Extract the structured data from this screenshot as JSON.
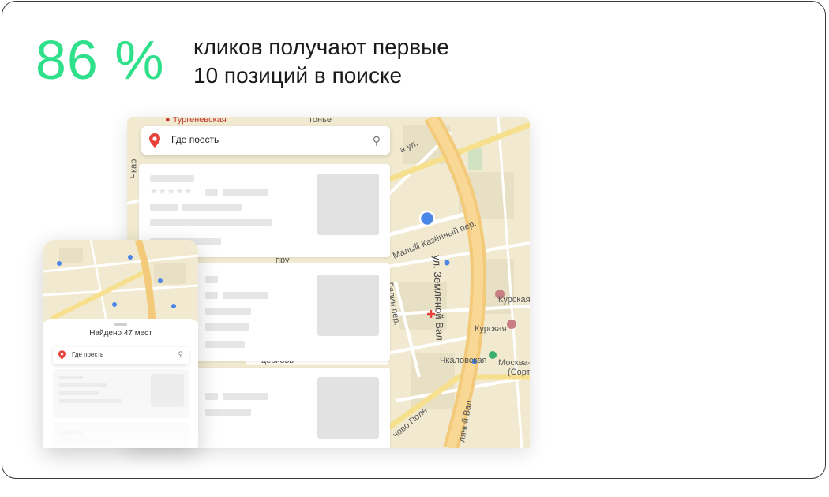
{
  "headline": {
    "stat": "86 %",
    "line1": "кликов получают первые",
    "line2": "10 позиций в поиске"
  },
  "colors": {
    "accent": "#2fe08a",
    "map_bg": "#f1ead0",
    "road": "#f3c97a",
    "pin_red": "#e8413a",
    "dot_blue": "#4a86e8"
  },
  "desktop": {
    "search": {
      "label": "Где поесть",
      "search_icon": "search-icon",
      "pin_icon": "map-pin-icon"
    },
    "map_labels": {
      "turgenevskaya": "Тургеневская",
      "val": "ул. Земляной Вал",
      "kazenny": "Малый Казённый пер.",
      "kurskaya1": "Курская",
      "kurskaya2": "Курская",
      "chkalovskaya": "Чкаловская",
      "moskva": "Москва-П",
      "moskva2": "(Сорт",
      "pole": "чово Поле",
      "val2": "ляной Вал",
      "lyalin": "Лялин пер.",
      "tserkov": "церковь",
      "pru": "пру",
      "chkar": "Чкар",
      "ul": "а ул.",
      "tonye": "тонье"
    }
  },
  "mobile": {
    "found": "Найдено 47 мест",
    "search": {
      "label": "Где поесть"
    }
  }
}
